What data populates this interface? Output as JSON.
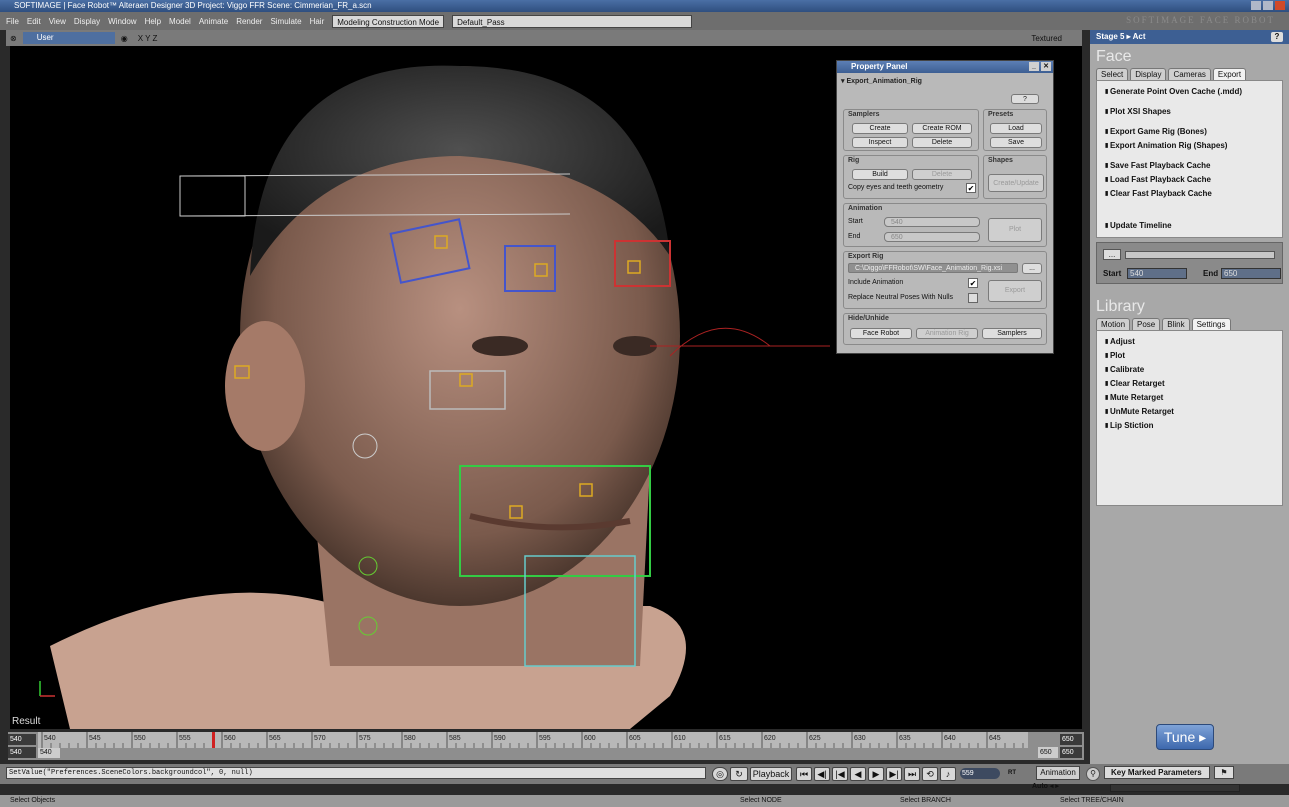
{
  "window": {
    "title": "SOFTIMAGE | Face Robot™ Alteraen Designer 3D Project: Viggo FFR  Scene: Cimmerian_FR_a.scn"
  },
  "menubar": {
    "items": [
      "File",
      "Edit",
      "View",
      "Display",
      "Window",
      "Help",
      "Model",
      "Animate",
      "Render",
      "Simulate",
      "Hair"
    ],
    "mode_combo": "Modeling Construction Mode",
    "pass_combo": "Default_Pass",
    "logo": "SOFTIMAGE FACE ROBOT"
  },
  "viewport": {
    "view": "User",
    "axes": "X Y Z",
    "display_mode": "Textured",
    "result_label": "Result"
  },
  "property_panel": {
    "title": "Property Panel",
    "header": "Export_Animation_Rig",
    "help_btn": "?",
    "samplers": {
      "label": "Samplers",
      "create": "Create",
      "create_rom": "Create ROM",
      "inspect": "Inspect",
      "delete": "Delete"
    },
    "presets": {
      "label": "Presets",
      "load": "Load",
      "save": "Save"
    },
    "rig": {
      "label": "Rig",
      "build": "Build",
      "delete": "Delete",
      "copy_eyes": "Copy eyes and teeth geometry",
      "copy_eyes_checked": true
    },
    "shapes": {
      "label": "Shapes",
      "create_update": "Create/Update"
    },
    "animation": {
      "label": "Animation",
      "start_label": "Start",
      "start_value": "540",
      "end_label": "End",
      "end_value": "650",
      "plot": "Plot"
    },
    "export_rig": {
      "label": "Export Rig",
      "path": "C:\\Diggo\\FFRobot\\SW\\Face_Animation_Rig.xsi",
      "browse": "...",
      "include_animation": "Include Animation",
      "include_animation_checked": true,
      "replace_neutral": "Replace Neutral Poses With Nulls",
      "replace_neutral_checked": false,
      "export": "Export"
    },
    "hide_unhide": {
      "label": "Hide/Unhide",
      "face_robot": "Face Robot",
      "animation_rig": "Animation Rig",
      "samplers": "Samplers"
    }
  },
  "right_panel": {
    "stage": "Stage 5 ▸ Act",
    "help": "?",
    "face": {
      "title": "Face",
      "tabs": [
        "Select",
        "Display",
        "Cameras",
        "Export"
      ],
      "active_tab": 3,
      "items": [
        "Generate Point Oven Cache (.mdd)",
        "Plot XSI Shapes",
        "Export Game Rig (Bones)",
        "Export Animation Rig (Shapes)",
        "Save Fast Playback Cache",
        "Load Fast Playback Cache",
        "Clear Fast Playback Cache",
        "Update Timeline"
      ],
      "dots": "...",
      "start_label": "Start",
      "start_value": "540",
      "end_label": "End",
      "end_value": "650"
    },
    "library": {
      "title": "Library",
      "tabs": [
        "Motion",
        "Pose",
        "Blink",
        "Settings"
      ],
      "active_tab": 3,
      "items": [
        "Adjust",
        "Plot",
        "Calibrate",
        "Clear Retarget",
        "Mute Retarget",
        "UnMute Retarget",
        "Lip Stiction"
      ]
    },
    "tune": "Tune ▸"
  },
  "timeline": {
    "start": "540",
    "start2": "540",
    "small_start": "540",
    "end": "650",
    "end2": "650",
    "small_end": "650",
    "ticks": [
      "540",
      "545",
      "550",
      "555",
      "560",
      "565",
      "570",
      "575",
      "580",
      "585",
      "590",
      "595",
      "600",
      "605",
      "610",
      "615",
      "620",
      "625",
      "630",
      "635",
      "640",
      "645"
    ],
    "current_frame": "559"
  },
  "command_bar": {
    "input": "SetValue(\"Preferences.SceneColors.backgroundcol\", 0, null)",
    "playback": "Playback",
    "frame": "559",
    "rt": "RT",
    "animation": "Animation",
    "auto": "Auto",
    "key_marked": "Key Marked Parameters"
  },
  "status_bar": {
    "left": "Select Objects",
    "node": "Select NODE",
    "branch": "Select BRANCH",
    "tree": "Select TREE/CHAIN"
  }
}
